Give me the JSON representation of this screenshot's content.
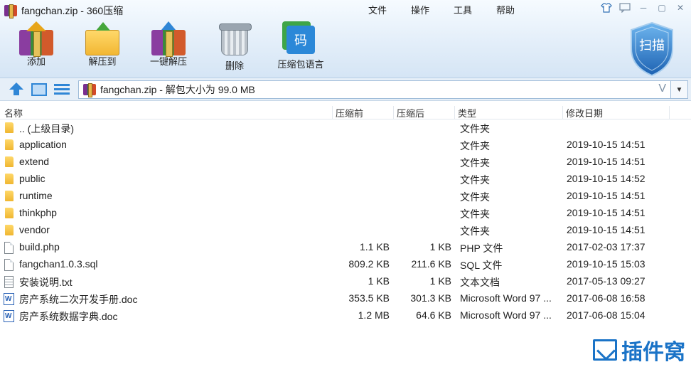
{
  "window": {
    "title": "fangchan.zip - 360压缩",
    "menu": [
      "文件",
      "操作",
      "工具",
      "帮助"
    ],
    "controls": {
      "skin": "shirt-icon",
      "feedback": "comment-icon",
      "minimize": "─",
      "restore": "▢",
      "close": "✕"
    }
  },
  "toolbar": {
    "add_label": "添加",
    "extract_to_label": "解压到",
    "one_click_label": "一键解压",
    "delete_label": "删除",
    "language_label": "压缩包语言",
    "language_icon_text": "码",
    "scan_label": "扫描"
  },
  "address": {
    "text": "fangchan.zip - 解包大小为 99.0 MB",
    "v_glyph": "V",
    "dropdown_glyph": "▼"
  },
  "columns": {
    "name": "名称",
    "packed": "压缩前",
    "size": "压缩后",
    "type": "类型",
    "modified": "修改日期"
  },
  "rows": [
    {
      "icon": "folder",
      "name": ".. (上级目录)",
      "packed": "",
      "size": "",
      "type": "文件夹",
      "modified": ""
    },
    {
      "icon": "folder",
      "name": "application",
      "packed": "",
      "size": "",
      "type": "文件夹",
      "modified": "2019-10-15 14:51"
    },
    {
      "icon": "folder",
      "name": "extend",
      "packed": "",
      "size": "",
      "type": "文件夹",
      "modified": "2019-10-15 14:51"
    },
    {
      "icon": "folder",
      "name": "public",
      "packed": "",
      "size": "",
      "type": "文件夹",
      "modified": "2019-10-15 14:52"
    },
    {
      "icon": "folder",
      "name": "runtime",
      "packed": "",
      "size": "",
      "type": "文件夹",
      "modified": "2019-10-15 14:51"
    },
    {
      "icon": "folder",
      "name": "thinkphp",
      "packed": "",
      "size": "",
      "type": "文件夹",
      "modified": "2019-10-15 14:51"
    },
    {
      "icon": "folder",
      "name": "vendor",
      "packed": "",
      "size": "",
      "type": "文件夹",
      "modified": "2019-10-15 14:51"
    },
    {
      "icon": "file",
      "name": "build.php",
      "packed": "1.1 KB",
      "size": "1 KB",
      "type": "PHP 文件",
      "modified": "2017-02-03 17:37"
    },
    {
      "icon": "file",
      "name": "fangchan1.0.3.sql",
      "packed": "809.2 KB",
      "size": "211.6 KB",
      "type": "SQL 文件",
      "modified": "2019-10-15 15:03"
    },
    {
      "icon": "txt",
      "name": "安装说明.txt",
      "packed": "1 KB",
      "size": "1 KB",
      "type": "文本文档",
      "modified": "2017-05-13 09:27"
    },
    {
      "icon": "word",
      "name": "房产系统二次开发手册.doc",
      "packed": "353.5 KB",
      "size": "301.3 KB",
      "type": "Microsoft Word 97 ...",
      "modified": "2017-06-08 16:58"
    },
    {
      "icon": "word",
      "name": "房产系统数据字典.doc",
      "packed": "1.2 MB",
      "size": "64.6 KB",
      "type": "Microsoft Word 97 ...",
      "modified": "2017-06-08 15:04"
    }
  ],
  "watermark": {
    "text": "插件窝"
  },
  "colors": {
    "accent": "#2f86d6",
    "folder": "#f0b630",
    "toolbar_bg": "#e3eef9"
  }
}
